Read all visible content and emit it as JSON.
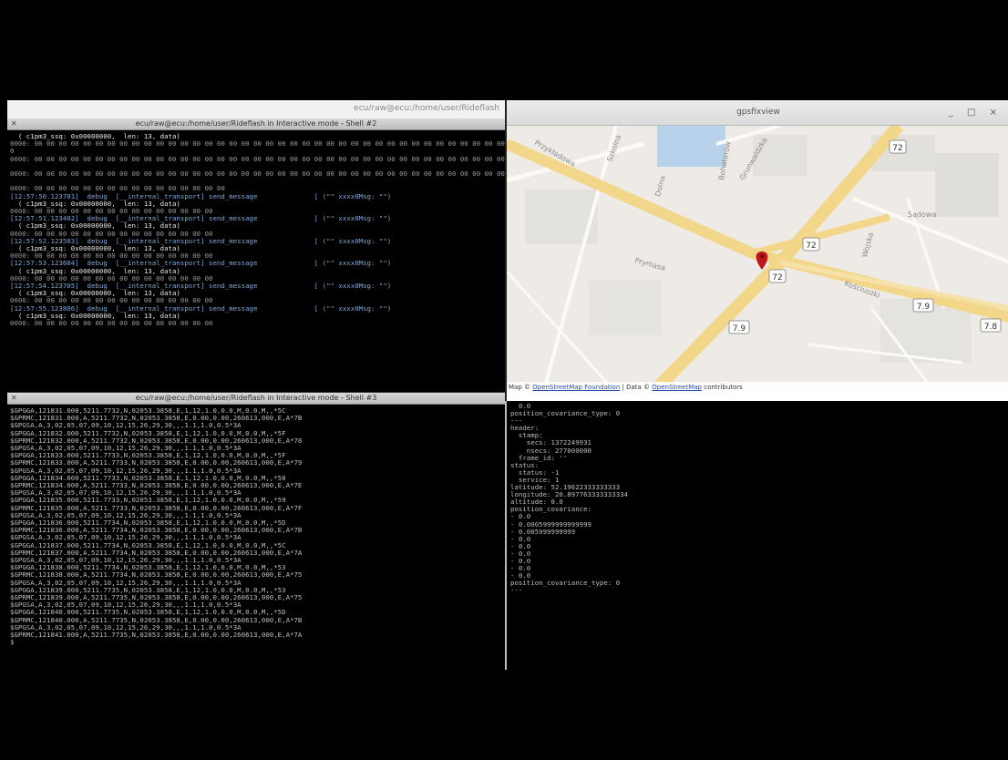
{
  "top_strip": {
    "text": "ecu/raw@ecu:/home/user/Rideflash"
  },
  "terminal_top": {
    "title": "ecu/raw@ecu:/home/user/Rideflash in Interactive mode - Shell #2",
    "lines": [
      {
        "t": "  ( c1pm3_ssq: 0x00000000,  len: 13, data)",
        "c": "white"
      },
      {
        "t": "0000: 00 00 00 00 00 00 00 00 00 00 00 00 00 00 00 00 00 00 00 00 00 00 00 00 00 00 00 00 00 00 00 00 00 00 00 00 00 00 00 0",
        "c": "dim"
      },
      {
        "t": "0",
        "c": "dim"
      },
      {
        "t": "0000: 00 00 00 00 00 00 00 00 00 00 00 00 00 00 00 00 00 00 00 00 00 00 00 00 00 00 00 00 00 00 00 00 00 00 00 00 00 00 00 0",
        "c": "dim"
      },
      {
        "t": "",
        "c": "dim"
      },
      {
        "t": "0000: 00 00 00 00 00 00 00 00 00 00 00 00 00 00 00 00 00 00 00 00 00 00 00 00 00 00 00 00 00 00 00 00 00 00 00 00 00 00 00 0",
        "c": "dim"
      },
      {
        "t": "",
        "c": "dim"
      },
      {
        "t": "0000: 00 00 00 00 00 00 00 00 00 00 00 00 00 00 00 00",
        "c": "dim"
      },
      {
        "t": "[12:57:50.123701]  debug  [__internal_transport] send_message              [ (\"\" xxxx0Msg: \"\")",
        "c": "cyan"
      },
      {
        "t": "  ( c1pm3_ssq: 0x00000000,  len: 13, data)",
        "c": "white"
      },
      {
        "t": "0000: 00 00 00 00 00 00 00 00 00 00 00 00 00 00 00",
        "c": "dim"
      },
      {
        "t": "[12:57:51.123402]  debug  [__internal_transport] send_message              [ (\"\" xxxx0Msg: \"\")",
        "c": "cyan"
      },
      {
        "t": "  ( c1pm3_ssq: 0x00000000,  len: 13, data)",
        "c": "white"
      },
      {
        "t": "0000: 00 00 00 00 00 00 00 00 00 00 00 00 00 00 00",
        "c": "dim"
      },
      {
        "t": "[12:57:52.123503]  debug  [__internal_transport] send_message              [ (\"\" xxxx0Msg: \"\")",
        "c": "cyan"
      },
      {
        "t": "  ( c1pm3_ssq: 0x00000000,  len: 13, data)",
        "c": "white"
      },
      {
        "t": "0000: 00 00 00 00 00 00 00 00 00 00 00 00 00 00 00",
        "c": "dim"
      },
      {
        "t": "[12:57:53.123604]  debug  [__internal_transport] send_message              [ (\"\" xxxx0Msg: \"\")",
        "c": "cyan"
      },
      {
        "t": "  ( c1pm3_ssq: 0x00000000,  len: 13, data)",
        "c": "white"
      },
      {
        "t": "0000: 00 00 00 00 00 00 00 00 00 00 00 00 00 00 00",
        "c": "dim"
      },
      {
        "t": "[12:57:54.123705]  debug  [__internal_transport] send_message              [ (\"\" xxxx0Msg: \"\")",
        "c": "cyan"
      },
      {
        "t": "  ( c1pm3_ssq: 0x00000000,  len: 13, data)",
        "c": "white"
      },
      {
        "t": "0000: 00 00 00 00 00 00 00 00 00 00 00 00 00 00 00",
        "c": "dim"
      },
      {
        "t": "[12:57:55.123806]  debug  [__internal_transport] send_message              [ (\"\" xxxx0Msg: \"\")",
        "c": "cyan"
      },
      {
        "t": "  ( c1pm3_ssq: 0x00000000,  len: 13, data)",
        "c": "white"
      },
      {
        "t": "0000: 00 00 00 00 00 00 00 00 00 00 00 00 00 00 00",
        "c": "dim"
      }
    ]
  },
  "terminal_bottom": {
    "title": "ecu/raw@ecu:/home/user/Rideflash in Interactive mode - Shell #3",
    "lines": [
      "$GPGGA,121831.000,5211.7732,N,02053.3858,E,1,12,1.0,0.0,M,0.0,M,,*5C",
      "$GPRMC,121831.000,A,5211.7732,N,02053.3858,E,0.00,0.00,260613,000,E,A*7B",
      "$GPGSA,A,3,02,05,07,09,10,12,15,26,29,30,,,1.1,1.0,0.5*3A",
      "$GPGGA,121832.000,5211.7732,N,02053.3858,E,1,12,1.0,0.0,M,0.0,M,,*5F",
      "$GPRMC,121832.000,A,5211.7732,N,02053.3858,E,0.00,0.00,260613,000,E,A*78",
      "$GPGSA,A,3,02,05,07,09,10,12,15,26,29,30,,,1.1,1.0,0.5*3A",
      "$GPGGA,121833.000,5211.7733,N,02053.3858,E,1,12,1.0,0.0,M,0.0,M,,*5F",
      "$GPRMC,121833.000,A,5211.7733,N,02053.3858,E,0.00,0.00,260613,000,E,A*79",
      "$GPGSA,A,3,02,05,07,09,10,12,15,26,29,30,,,1.1,1.0,0.5*3A",
      "$GPGGA,121834.000,5211.7733,N,02053.3858,E,1,12,1.0,0.0,M,0.0,M,,*58",
      "$GPRMC,121834.000,A,5211.7733,N,02053.3858,E,0.00,0.00,260613,000,E,A*7E",
      "$GPGSA,A,3,02,05,07,09,10,12,15,26,29,30,,,1.1,1.0,0.5*3A",
      "$GPGGA,121835.000,5211.7733,N,02053.3858,E,1,12,1.0,0.0,M,0.0,M,,*59",
      "$GPRMC,121835.000,A,5211.7733,N,02053.3858,E,0.00,0.00,260613,000,E,A*7F",
      "$GPGSA,A,3,02,05,07,09,10,12,15,26,29,30,,,1.1,1.0,0.5*3A",
      "$GPGGA,121836.000,5211.7734,N,02053.3858,E,1,12,1.0,0.0,M,0.0,M,,*5D",
      "$GPRMC,121836.000,A,5211.7734,N,02053.3858,E,0.00,0.00,260613,000,E,A*7B",
      "$GPGSA,A,3,02,05,07,09,10,12,15,26,29,30,,,1.1,1.0,0.5*3A",
      "$GPGGA,121837.000,5211.7734,N,02053.3858,E,1,12,1.0,0.0,M,0.0,M,,*5C",
      "$GPRMC,121837.000,A,5211.7734,N,02053.3858,E,0.00,0.00,260613,000,E,A*7A",
      "$GPGSA,A,3,02,05,07,09,10,12,15,26,29,30,,,1.1,1.0,0.5*3A",
      "$GPGGA,121838.000,5211.7734,N,02053.3858,E,1,12,1.0,0.0,M,0.0,M,,*53",
      "$GPRMC,121838.000,A,5211.7734,N,02053.3858,E,0.00,0.00,260613,000,E,A*75",
      "$GPGSA,A,3,02,05,07,09,10,12,15,26,29,30,,,1.1,1.0,0.5*3A",
      "$GPGGA,121839.000,5211.7735,N,02053.3858,E,1,12,1.0,0.0,M,0.0,M,,*53",
      "$GPRMC,121839.000,A,5211.7735,N,02053.3858,E,0.00,0.00,260613,000,E,A*75",
      "$GPGSA,A,3,02,05,07,09,10,12,15,26,29,30,,,1.1,1.0,0.5*3A",
      "$GPGGA,121840.000,5211.7735,N,02053.3858,E,1,12,1.0,0.0,M,0.0,M,,*5D",
      "$GPRMC,121840.000,A,5211.7735,N,02053.3858,E,0.00,0.00,260613,000,E,A*7B",
      "$GPGSA,A,3,02,05,07,09,10,12,15,26,29,30,,,1.1,1.0,0.5*3A",
      "$GPRMC,121841.000,A,5211.7735,N,02053.3858,E,0.00,0.00,260613,000,E,A*7A",
      "$"
    ]
  },
  "map_window": {
    "title": "gpsfixview",
    "controls": "_ □ ×",
    "labels": [
      "Przykładowa",
      "Szkolna",
      "Bohaterów",
      "Dolna",
      "Grunwaldzka",
      "Prymasa",
      "Sądowa",
      "Wojska",
      "Kościuszki"
    ],
    "shields": [
      "72",
      "72",
      "72",
      "7.9",
      "7.9",
      "7.8"
    ],
    "attribution": {
      "prefix": "Map © ",
      "link1": "OpenStreetMap Foundation",
      "middle": " | Data © ",
      "link2": "OpenStreetMap",
      "suffix": " contributors"
    }
  },
  "terminal_right": {
    "lines": [
      "  0.0",
      "position_covariance_type: 0",
      "---",
      "header:",
      "  stamp:",
      "    secs: 1372249931",
      "    nsecs: 277000000",
      "  frame_id: ''",
      "status:",
      "  status: -1",
      "  service: 1",
      "latitude: 52.19622333333333",
      "longitude: 20.897763333333334",
      "altitude: 0.0",
      "position_covariance:",
      "- 0.0",
      "- 0.0005999999999999",
      "- 0.005999999999",
      "- 0.0",
      "- 0.0",
      "- 0.0",
      "- 0.0",
      "- 0.0",
      "- 0.0",
      "position_covariance_type: 0",
      "---"
    ]
  },
  "colors": {
    "accent_marker": "#c0151b",
    "road_major": "#f2d68a",
    "map_bg": "#eeebe6"
  }
}
